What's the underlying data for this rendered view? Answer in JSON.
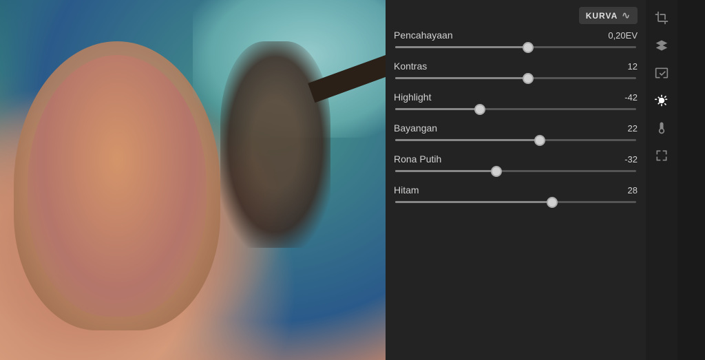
{
  "photo": {
    "alt": "Woman in hijab with sunglasses against sky background"
  },
  "panel": {
    "kurva_label": "KURVA",
    "sliders": [
      {
        "id": "pencahayaan",
        "label": "Pencahayaan",
        "value": "0,20EV",
        "percent": 55,
        "thumbPos": 55
      },
      {
        "id": "kontras",
        "label": "Kontras",
        "value": "12",
        "percent": 55,
        "thumbPos": 55
      },
      {
        "id": "highlight",
        "label": "Highlight",
        "value": "-42",
        "percent": 35,
        "thumbPos": 35
      },
      {
        "id": "bayangan",
        "label": "Bayangan",
        "value": "22",
        "percent": 60,
        "thumbPos": 60
      },
      {
        "id": "rona-putih",
        "label": "Rona Putih",
        "value": "-32",
        "percent": 42,
        "thumbPos": 42
      },
      {
        "id": "hitam",
        "label": "Hitam",
        "value": "28",
        "percent": 65,
        "thumbPos": 65
      }
    ],
    "sidebar_icons": [
      {
        "id": "crop",
        "symbol": "⤢",
        "active": false
      },
      {
        "id": "layers",
        "symbol": "⧉",
        "active": false
      },
      {
        "id": "image-edit",
        "symbol": "⊞",
        "active": false
      },
      {
        "id": "light",
        "symbol": "✳",
        "active": true
      },
      {
        "id": "temperature",
        "symbol": "🌡",
        "active": false
      },
      {
        "id": "frame",
        "symbol": "◫",
        "active": false
      }
    ]
  }
}
